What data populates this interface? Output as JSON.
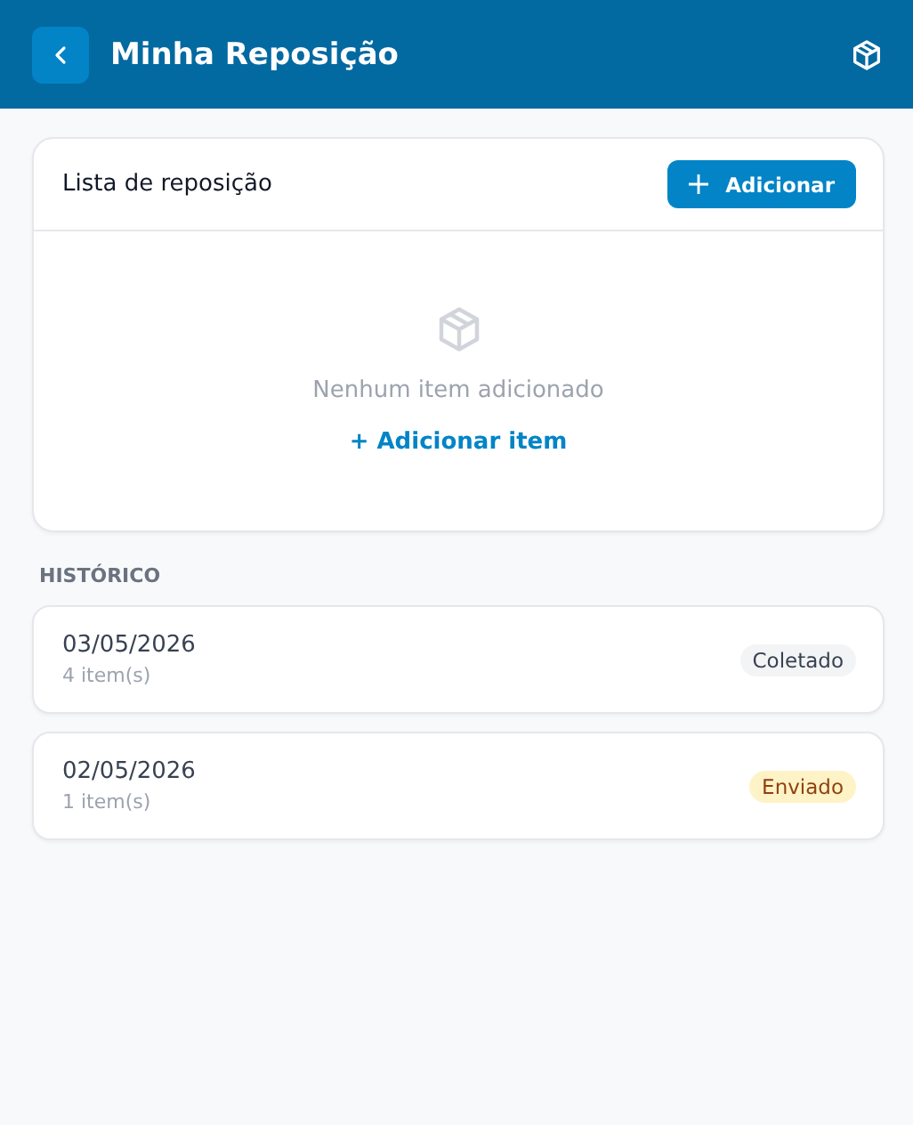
{
  "header": {
    "title": "Minha Reposição"
  },
  "list_card": {
    "title": "Lista de reposição",
    "add_button": "Adicionar",
    "empty_text": "Nenhum item adicionado",
    "add_item_link": "+ Adicionar item"
  },
  "history": {
    "heading": "HISTÓRICO",
    "entries": [
      {
        "date": "03/05/2026",
        "count": "4 item(s)",
        "status": "Coletado",
        "kind": "collected"
      },
      {
        "date": "02/05/2026",
        "count": "1 item(s)",
        "status": "Enviado",
        "kind": "sent"
      }
    ]
  }
}
